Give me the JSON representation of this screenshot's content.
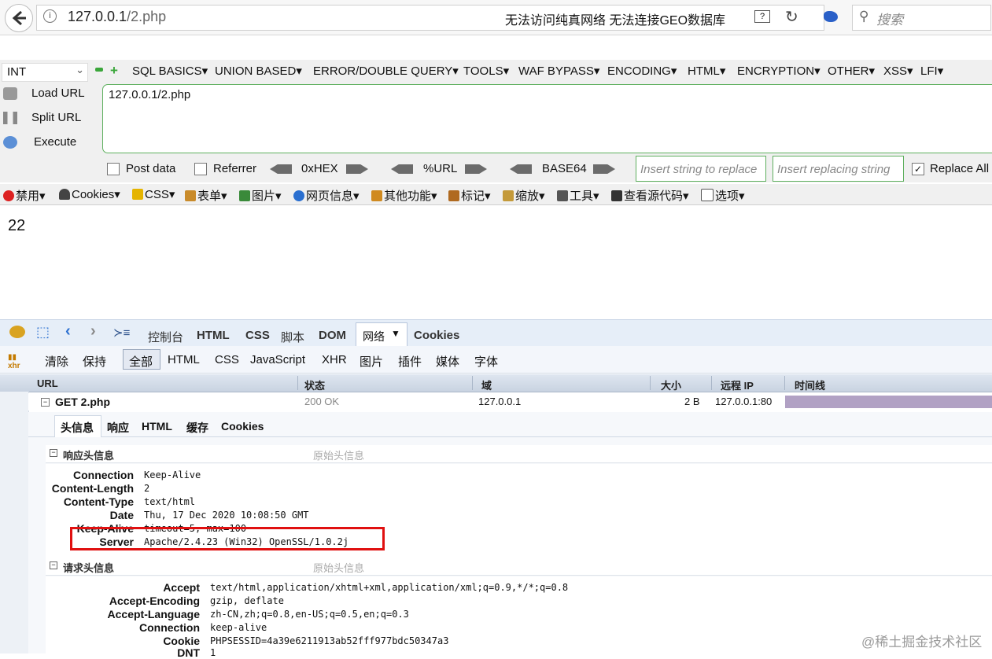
{
  "browser": {
    "url_host": "127.0.0.1",
    "url_path": "/2.php",
    "status_text": "无法访问纯真网络   无法连接GEO数据库",
    "search_placeholder": "搜索"
  },
  "hackbar": {
    "select_value": "INT",
    "menus": [
      "SQL BASICS",
      "UNION BASED",
      "ERROR/DOUBLE QUERY",
      "TOOLS",
      "WAF BYPASS",
      "ENCODING",
      "HTML",
      "ENCRYPTION",
      "OTHER",
      "XSS",
      "LFI"
    ],
    "load_url": "Load URL",
    "split_url": "Split URL",
    "execute": "Execute",
    "url_value": "127.0.0.1/2.php",
    "post_data": "Post data",
    "referrer": "Referrer",
    "hex": "0xHEX",
    "urlenc": "%URL",
    "base64": "BASE64",
    "replace_placeholder": "Insert string to replace",
    "replacing_placeholder": "Insert replacing string",
    "replace_all": "Replace All"
  },
  "toolbar2": [
    "禁用",
    "Cookies",
    "CSS",
    "表单",
    "图片",
    "网页信息",
    "其他功能",
    "标记",
    "缩放",
    "工具",
    "查看源代码",
    "选项"
  ],
  "page": {
    "content": "22"
  },
  "firebug": {
    "tabs": [
      "控制台",
      "HTML",
      "CSS",
      "脚本",
      "DOM",
      "网络",
      "Cookies"
    ],
    "sub": [
      "清除",
      "保持",
      "全部",
      "HTML",
      "CSS",
      "JavaScript",
      "XHR",
      "图片",
      "插件",
      "媒体",
      "字体"
    ],
    "columns": [
      "URL",
      "状态",
      "域",
      "大小",
      "远程 IP",
      "时间线"
    ],
    "request": {
      "name": "GET 2.php",
      "status": "200 OK",
      "domain": "127.0.0.1",
      "size": "2 B",
      "remote_ip": "127.0.0.1:80"
    },
    "detail_tabs": [
      "头信息",
      "响应",
      "HTML",
      "缓存",
      "Cookies"
    ],
    "response_section": "响应头信息",
    "request_section": "请求头信息",
    "raw_label": "原始头信息",
    "response_headers": [
      {
        "k": "Connection",
        "v": "Keep-Alive"
      },
      {
        "k": "Content-Length",
        "v": "2"
      },
      {
        "k": "Content-Type",
        "v": "text/html"
      },
      {
        "k": "Date",
        "v": "Thu, 17 Dec 2020 10:08:50 GMT"
      },
      {
        "k": "Keep-Alive",
        "v": "timeout=5, max=100"
      },
      {
        "k": "Server",
        "v": "Apache/2.4.23 (Win32) OpenSSL/1.0.2j"
      }
    ],
    "request_headers": [
      {
        "k": "Accept",
        "v": "text/html,application/xhtml+xml,application/xml;q=0.9,*/*;q=0.8"
      },
      {
        "k": "Accept-Encoding",
        "v": "gzip, deflate"
      },
      {
        "k": "Accept-Language",
        "v": "zh-CN,zh;q=0.8,en-US;q=0.5,en;q=0.3"
      },
      {
        "k": "Connection",
        "v": "keep-alive"
      },
      {
        "k": "Cookie",
        "v": "PHPSESSID=4a39e6211913ab52fff977bdc50347a3"
      },
      {
        "k": "DNT",
        "v": "1"
      }
    ]
  },
  "watermark": "@稀土掘金技术社区",
  "colors": {
    "highlight": "#e01010",
    "hackbar_green": "#5fb05f",
    "timeline": "#b1a1c4"
  }
}
